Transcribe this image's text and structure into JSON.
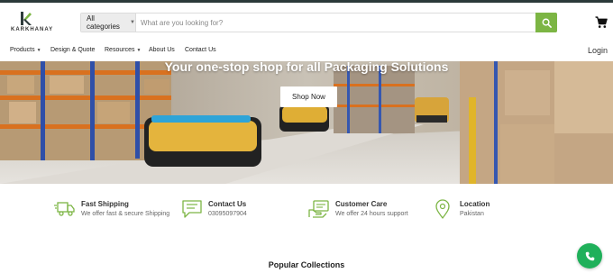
{
  "brand": {
    "name": "KARKHANAY"
  },
  "search": {
    "category": "All categories",
    "placeholder": "What are you looking for?"
  },
  "nav": {
    "items": [
      {
        "label": "Products",
        "has_dropdown": true
      },
      {
        "label": "Design & Quote",
        "has_dropdown": false
      },
      {
        "label": "Resources",
        "has_dropdown": true
      },
      {
        "label": "About Us",
        "has_dropdown": false
      },
      {
        "label": "Contact Us",
        "has_dropdown": false
      }
    ],
    "login": "Login"
  },
  "hero": {
    "title": "Your one-stop shop for all Packaging Solutions",
    "cta": "Shop Now"
  },
  "features": [
    {
      "icon": "truck-icon",
      "title": "Fast Shipping",
      "subtitle": "We offer fast & secure Shipping"
    },
    {
      "icon": "chat-icon",
      "title": "Contact Us",
      "subtitle": "03095097904"
    },
    {
      "icon": "support-icon",
      "title": "Customer Care",
      "subtitle": "We offer 24 hours support"
    },
    {
      "icon": "location-pin-icon",
      "title": "Location",
      "subtitle": "Pakistan"
    }
  ],
  "sections": {
    "popular_title": "Popular Collections"
  },
  "colors": {
    "accent": "#7cb544",
    "call": "#1fb05a",
    "topbar": "#2b3a3a"
  }
}
